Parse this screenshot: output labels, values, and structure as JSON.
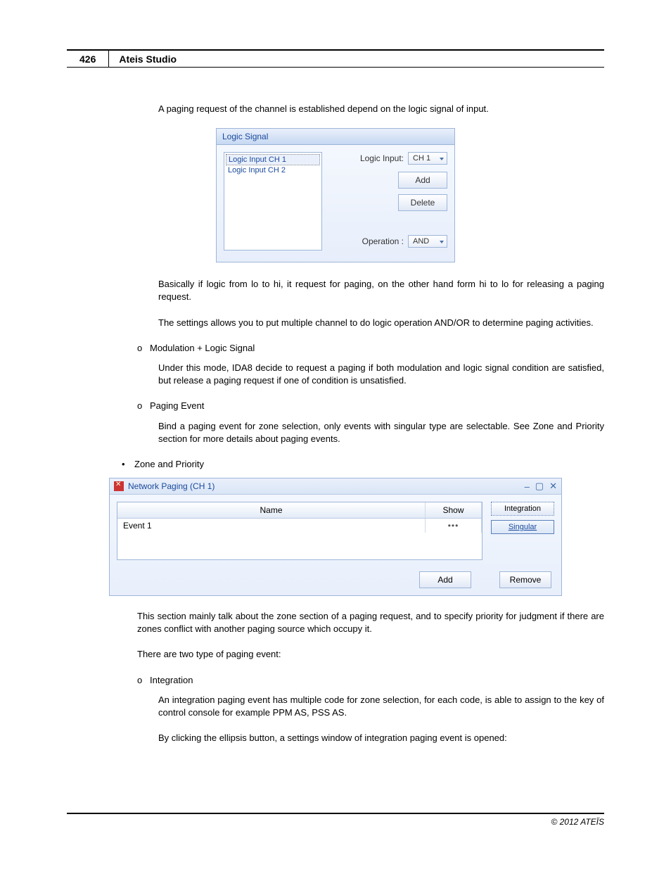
{
  "header": {
    "page_number": "426",
    "title": "Ateis Studio"
  },
  "paragraphs": {
    "p1": "A paging request of the channel is established depend on the logic signal of input.",
    "p2": "Basically if logic from lo to hi, it request for paging, on the other hand form hi to lo for releasing a paging request.",
    "p3": "The settings allows you to put multiple channel to do logic operation AND/OR to determine paging activities.",
    "b1": "Modulation + Logic Signal",
    "p4": "Under this mode, IDA8 decide to request a paging if both modulation and logic signal condition are satisfied, but release a paging request if one of condition is unsatisfied.",
    "b2": "Paging Event",
    "p5": "Bind a paging event for zone selection, only events with singular type are selectable. See Zone and Priority section for more details about paging events.",
    "bsolid": "Zone and Priority",
    "p6": "This section mainly talk about the zone section of a paging request, and to specify priority for judgment if there are zones conflict with another paging source which occupy it.",
    "p7": "There are two type of paging event:",
    "b3": "Integration",
    "p8": "An integration paging event has multiple code for zone selection, for each code, is able to assign to the key of control console for example PPM AS, PSS AS.",
    "p9": "By clicking the ellipsis button, a settings window of integration paging event is opened:"
  },
  "logic_panel": {
    "title": "Logic Signal",
    "list": {
      "item1": "Logic Input CH 1",
      "item2": "Logic Input CH 2"
    },
    "label_input": "Logic Input:",
    "combo_input": "CH 1",
    "btn_add": "Add",
    "btn_delete": "Delete",
    "label_op": "Operation :",
    "combo_op": "AND"
  },
  "np_panel": {
    "title": "Network Paging (CH 1)",
    "th_name": "Name",
    "th_show": "Show",
    "row1_name": "Event 1",
    "row1_show": "•••",
    "side_integration": "Integration",
    "side_singular": "Singular",
    "footer_add": "Add",
    "footer_remove": "Remove",
    "win_min": "–",
    "win_max": "▢",
    "win_close": "✕"
  },
  "footer": "© 2012 ATEÏS"
}
